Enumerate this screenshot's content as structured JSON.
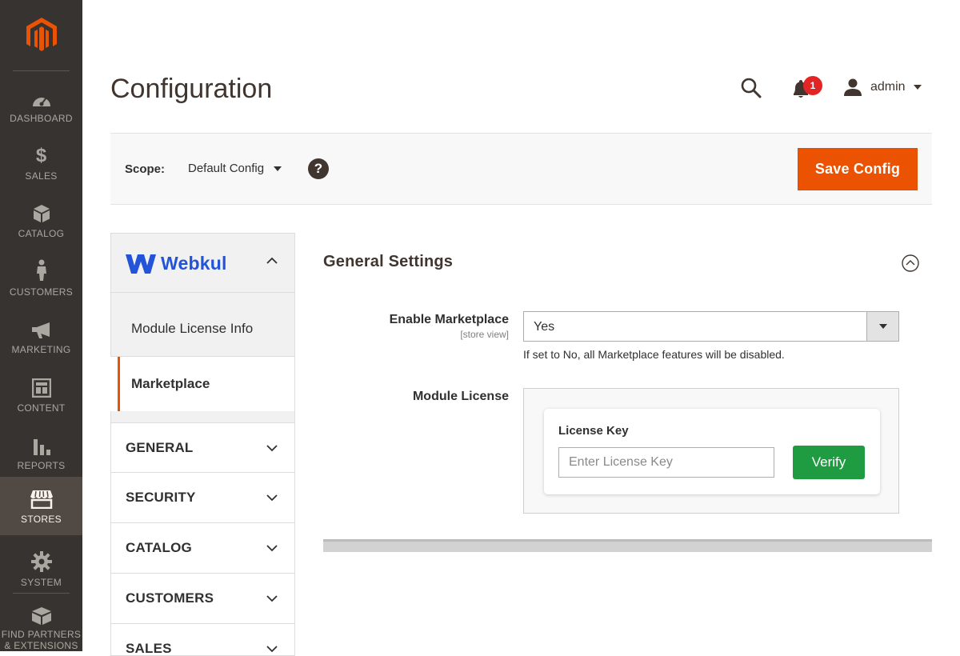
{
  "nav": {
    "items": [
      {
        "label": "DASHBOARD",
        "icon": "dashboard-icon"
      },
      {
        "label": "SALES",
        "icon": "dollar-icon"
      },
      {
        "label": "CATALOG",
        "icon": "box-icon"
      },
      {
        "label": "CUSTOMERS",
        "icon": "person-icon"
      },
      {
        "label": "MARKETING",
        "icon": "megaphone-icon"
      },
      {
        "label": "CONTENT",
        "icon": "layout-icon"
      },
      {
        "label": "REPORTS",
        "icon": "bar-chart-icon"
      },
      {
        "label": "STORES",
        "icon": "store-icon"
      },
      {
        "label": "SYSTEM",
        "icon": "gear-icon"
      },
      {
        "label": "FIND PARTNERS",
        "label2": "& EXTENSIONS",
        "icon": "extensions-icon"
      }
    ],
    "active": "STORES"
  },
  "header": {
    "title": "Configuration",
    "notification_count": "1",
    "user": "admin"
  },
  "scope": {
    "label": "Scope:",
    "value": "Default Config",
    "help": "?",
    "save_label": "Save Config"
  },
  "tabs": {
    "brand": "Webkul",
    "sub_items": [
      "Module License Info",
      "Marketplace"
    ],
    "active_sub": "Marketplace",
    "groups": [
      "GENERAL",
      "SECURITY",
      "CATALOG",
      "CUSTOMERS",
      "SALES"
    ]
  },
  "section": {
    "title": "General Settings",
    "fields": {
      "enable_marketplace": {
        "label": "Enable Marketplace",
        "scope": "[store view]",
        "value": "Yes",
        "note": "If set to No, all Marketplace features will be disabled."
      },
      "module_license": {
        "label": "Module License",
        "card_title": "License Key",
        "placeholder": "Enter License Key",
        "verify_label": "Verify"
      }
    }
  },
  "colors": {
    "nav_bg": "#373330",
    "nav_active": "#514943",
    "accent": "#eb5202",
    "verify": "#1f9c42",
    "webkul": "#2353d8",
    "badge": "#e22626"
  }
}
